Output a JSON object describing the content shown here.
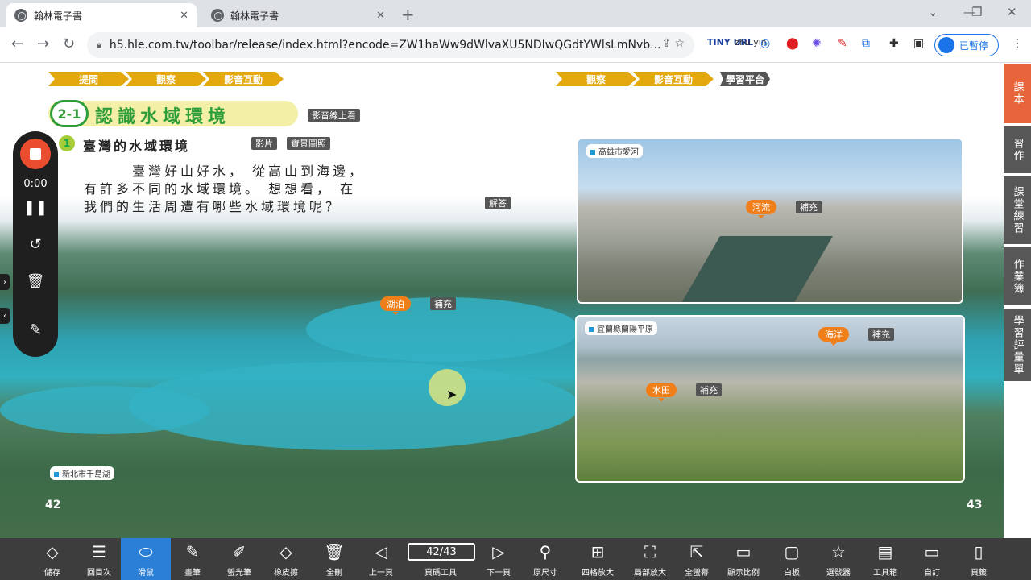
{
  "browser": {
    "tabs": [
      {
        "title": "翰林電子書",
        "active": true
      },
      {
        "title": "翰林電子書",
        "active": false
      }
    ],
    "url": "h5.hle.com.tw/toolbar/release/index.html?encode=ZW1haWw9dWlvaXU5NDIwQGdtYWlsLmNvb...",
    "profile_label": "已暫停",
    "extensions": [
      "TINY URL",
      "zhu yin"
    ]
  },
  "book": {
    "top_nav_left": [
      "提問",
      "觀察",
      "影音互動"
    ],
    "top_nav_right": [
      "觀察",
      "影音互動"
    ],
    "top_nav_right_tag": "學習平台",
    "lesson_number": "2-1",
    "lesson_title": "認識水域環境",
    "lesson_tag": "影音線上看",
    "section_number": "1",
    "section_title": "臺灣的水域環境",
    "section_tags": [
      "影片",
      "實景圖照"
    ],
    "paragraph": [
      "臺灣好山好水， 從高山到海邊，",
      "有許多不同的水域環境。 想想看， 在",
      "我們的生活周遭有哪些水域環境呢？"
    ],
    "answer_tag": "解答",
    "main_photo_label": "新北市千島湖",
    "main_pin": {
      "label": "湖泊",
      "tag": "補充"
    },
    "photo_top": {
      "label": "高雄市愛河",
      "pin": "河流",
      "tag": "補充"
    },
    "photo_bottom": {
      "label": "宜蘭縣蘭陽平原",
      "pins": [
        {
          "label": "海洋",
          "tag": "補充"
        },
        {
          "label": "水田",
          "tag": "補充"
        }
      ]
    },
    "page_left": "42",
    "page_right": "43"
  },
  "side_tabs": [
    "課本",
    "習作",
    "課堂練習",
    "作業簿",
    "學習評量單"
  ],
  "recorder": {
    "time": "0:00"
  },
  "bottom_toolbar": {
    "page_indicator": "42/43",
    "tools": [
      "儲存",
      "回目次",
      "滑鼠",
      "畫筆",
      "螢光筆",
      "橡皮擦",
      "全刪",
      "上一頁",
      "頁碼工具",
      "下一頁",
      "原尺寸",
      "四格放大",
      "局部放大",
      "全螢幕",
      "顯示比例",
      "白板",
      "選號器",
      "工具箱",
      "自訂",
      "頁籤"
    ],
    "active_tool": "滑鼠"
  },
  "colors": {
    "accent": "#e8643a",
    "chevron": "#e4a80f",
    "title_green": "#2e9d3a",
    "toolbar_active": "#2b7fd6"
  }
}
